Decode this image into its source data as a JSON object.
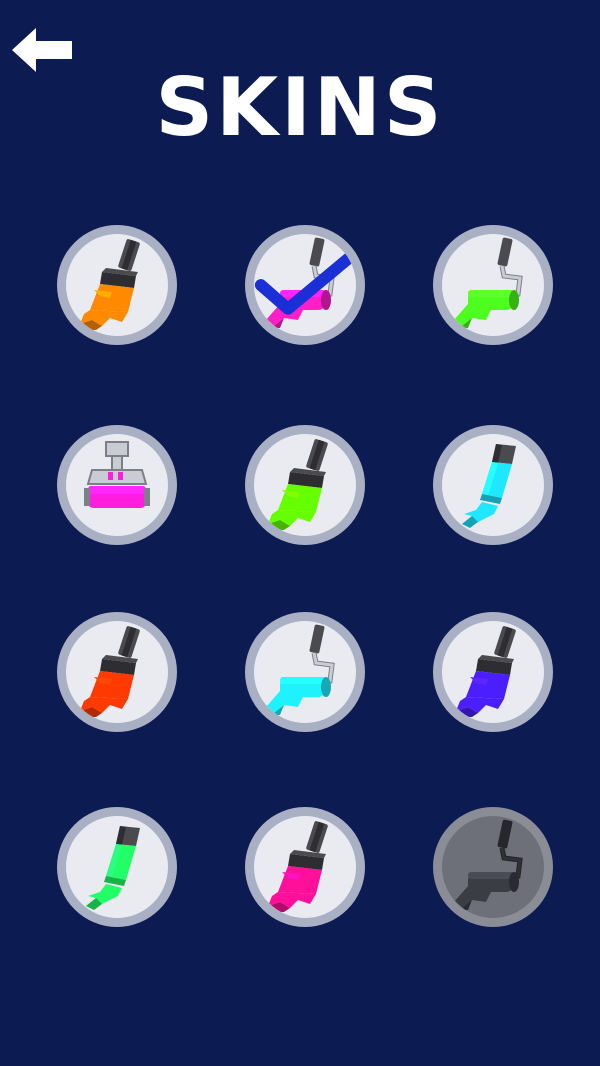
{
  "header": {
    "title": "SKINS",
    "back_icon": "arrow-left-icon"
  },
  "skins": [
    {
      "tool": "brush",
      "color": "#ff8a00",
      "selected": false,
      "locked": false
    },
    {
      "tool": "roller",
      "color": "#ff1ec8",
      "selected": true,
      "locked": false
    },
    {
      "tool": "roller",
      "color": "#4cff1e",
      "selected": false,
      "locked": false
    },
    {
      "tool": "wide-roller",
      "color": "#ff1ee0",
      "selected": false,
      "locked": false
    },
    {
      "tool": "brush",
      "color": "#66ff00",
      "selected": false,
      "locked": false
    },
    {
      "tool": "tube",
      "color": "#1ee8ff",
      "selected": false,
      "locked": false
    },
    {
      "tool": "brush",
      "color": "#ff3a00",
      "selected": false,
      "locked": false
    },
    {
      "tool": "roller",
      "color": "#1ef2ff",
      "selected": false,
      "locked": false
    },
    {
      "tool": "brush",
      "color": "#4a1eff",
      "selected": false,
      "locked": false
    },
    {
      "tool": "tube",
      "color": "#22ff66",
      "selected": false,
      "locked": false
    },
    {
      "tool": "brush",
      "color": "#ff0f9a",
      "selected": false,
      "locked": false
    },
    {
      "tool": "roller",
      "color": "#3b3d44",
      "selected": false,
      "locked": true
    }
  ],
  "colors": {
    "background": "#0c1b52",
    "check": "#1a2fd6"
  }
}
